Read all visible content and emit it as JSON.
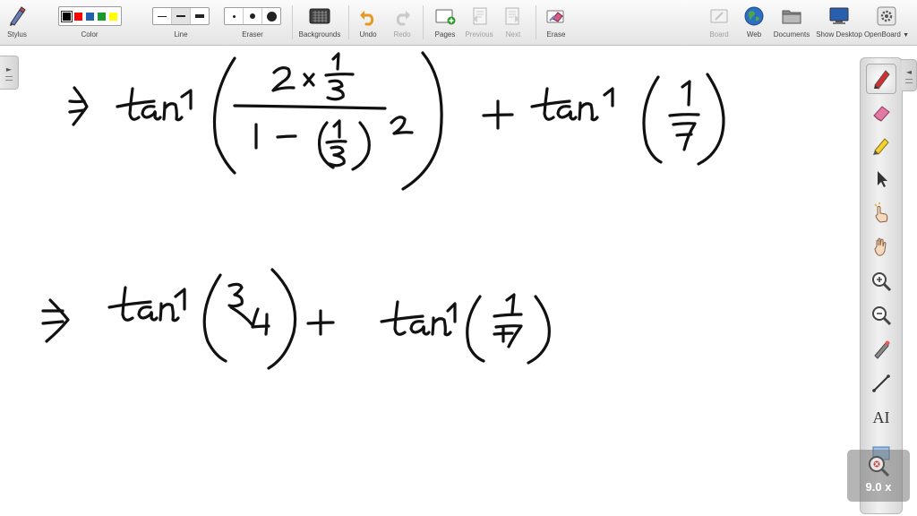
{
  "toolbar": {
    "stylus_label": "Stylus",
    "color_label": "Color",
    "line_label": "Line",
    "eraser_label": "Eraser",
    "backgrounds_label": "Backgrounds",
    "undo_label": "Undo",
    "redo_label": "Redo",
    "pages_label": "Pages",
    "previous_label": "Previous",
    "next_label": "Next",
    "erase_label": "Erase",
    "board_label": "Board",
    "web_label": "Web",
    "documents_label": "Documents",
    "show_desktop_label": "Show Desktop",
    "openboard_label": "OpenBoard"
  },
  "colors": [
    "#000000",
    "#ff0000",
    "#1f5fb0",
    "#1a9a2a",
    "#ffff00"
  ],
  "selected_color": "#000000",
  "dock": {
    "tools": [
      "pen-icon",
      "eraser-icon",
      "highlighter-icon",
      "pointer-icon",
      "hand-pointer-icon",
      "hand-icon",
      "zoom-in-icon",
      "zoom-out-icon",
      "laser-pointer-icon",
      "line-icon",
      "text-icon",
      "capture-icon"
    ],
    "text_tool_label": "AI",
    "zoom_level": "9.0 x"
  }
}
